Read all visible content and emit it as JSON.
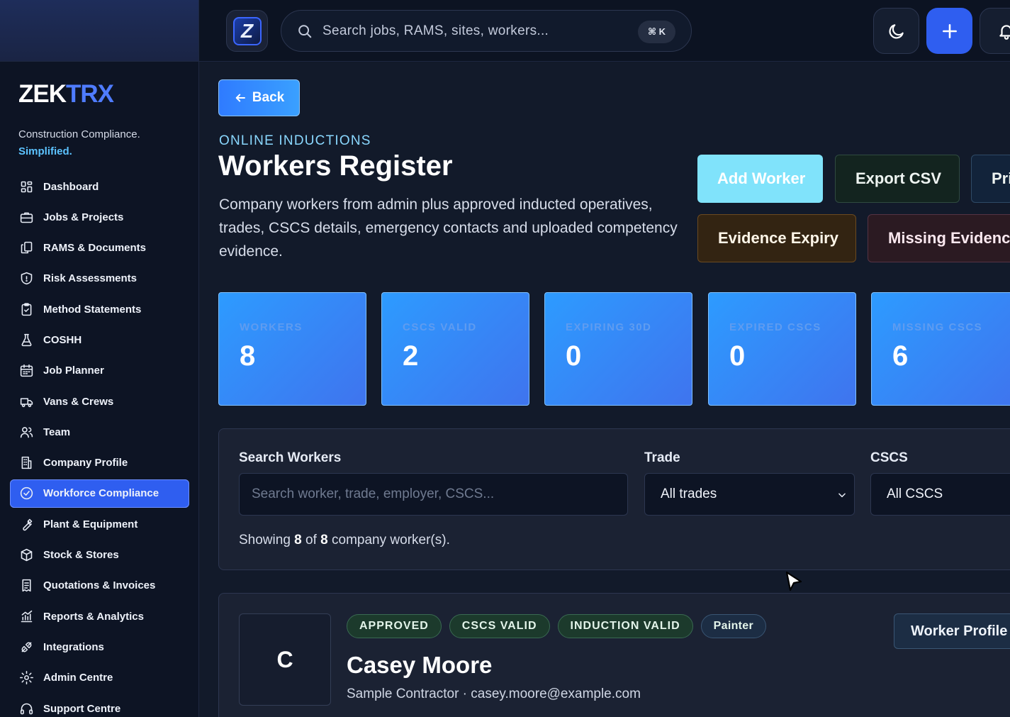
{
  "brand": {
    "name_part1": "ZEK",
    "name_part2": "TRX",
    "tagline": "Construction Compliance.",
    "tagline_highlight": "Simplified."
  },
  "app_logo_letter": "Z",
  "search": {
    "placeholder": "Search jobs, RAMS, sites, workers...",
    "shortcut": "⌘ K"
  },
  "sidebar": {
    "items": [
      {
        "label": "Dashboard",
        "icon": "dashboard-icon"
      },
      {
        "label": "Jobs & Projects",
        "icon": "briefcase-icon"
      },
      {
        "label": "RAMS & Documents",
        "icon": "documents-icon"
      },
      {
        "label": "Risk Assessments",
        "icon": "shield-icon"
      },
      {
        "label": "Method Statements",
        "icon": "clipboard-icon"
      },
      {
        "label": "COSHH",
        "icon": "flask-icon"
      },
      {
        "label": "Job Planner",
        "icon": "calendar-icon"
      },
      {
        "label": "Vans & Crews",
        "icon": "van-icon"
      },
      {
        "label": "Team",
        "icon": "users-icon"
      },
      {
        "label": "Company Profile",
        "icon": "building-icon"
      },
      {
        "label": "Workforce Compliance",
        "icon": "check-circle-icon",
        "active": true
      },
      {
        "label": "Plant & Equipment",
        "icon": "wrench-icon"
      },
      {
        "label": "Stock & Stores",
        "icon": "box-icon"
      },
      {
        "label": "Quotations & Invoices",
        "icon": "invoice-icon"
      },
      {
        "label": "Reports & Analytics",
        "icon": "chart-icon"
      },
      {
        "label": "Integrations",
        "icon": "plug-icon"
      },
      {
        "label": "Admin Centre",
        "icon": "gear-icon"
      },
      {
        "label": "Support Centre",
        "icon": "headset-icon"
      }
    ]
  },
  "page": {
    "back_label": "Back",
    "eyebrow": "ONLINE INDUCTIONS",
    "title": "Workers Register",
    "description": "Company workers from admin plus approved inducted operatives, trades, CSCS details, emergency contacts and uploaded competency evidence."
  },
  "actions": {
    "add_worker": "Add Worker",
    "export_csv": "Export CSV",
    "print": "Pri",
    "evidence_expiry": "Evidence Expiry",
    "missing_evidence": "Missing Evidence"
  },
  "stats": [
    {
      "label": "WORKERS",
      "value": "8"
    },
    {
      "label": "CSCS VALID",
      "value": "2"
    },
    {
      "label": "EXPIRING 30D",
      "value": "0"
    },
    {
      "label": "EXPIRED CSCS",
      "value": "0"
    },
    {
      "label": "MISSING CSCS",
      "value": "6"
    }
  ],
  "filters": {
    "search_label": "Search Workers",
    "search_placeholder": "Search worker, trade, employer, CSCS...",
    "trade_label": "Trade",
    "trade_value": "All trades",
    "cscs_label": "CSCS",
    "cscs_value": "All CSCS",
    "showing_prefix": "Showing",
    "showing_count": "8",
    "showing_of": "of",
    "showing_total": "8",
    "showing_suffix": "company worker(s)."
  },
  "worker": {
    "initial": "C",
    "badges": [
      "APPROVED",
      "CSCS VALID",
      "INDUCTION VALID"
    ],
    "trade": "Painter",
    "name": "Casey Moore",
    "meta": "Sample Contractor · casey.moore@example.com",
    "profile_label": "Worker Profile"
  },
  "colors": {
    "accent": "#2f5ef0",
    "stat_card": "#3f74ee",
    "highlight": "#5cc3ff"
  }
}
